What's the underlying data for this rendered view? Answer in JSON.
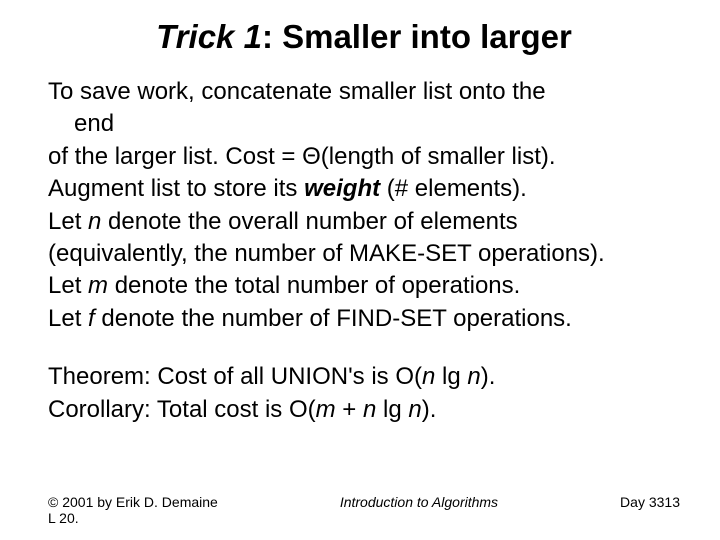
{
  "title_em": "Trick 1",
  "title_rest": ": Smaller into larger",
  "p1a": "To save work, concatenate smaller list onto the",
  "p1b": "end",
  "p2a": "of the larger list. Cost = ",
  "p2b": "Θ",
  "p2c": "(length of smaller list).",
  "p3a": "Augment list to store its ",
  "p3_weight": "weight",
  "p3b": " (# elements).",
  "p4a": "Let ",
  "p4_n": "n",
  "p4b": " denote the overall number of elements",
  "p5": "(equivalently, the number of MAKE-SET operations).",
  "p6a": "Let ",
  "p6_m": "m",
  "p6b": " denote the total number of operations.",
  "p7a": "Let ",
  "p7_f": "f",
  "p7b": " denote the number of FIND-SET operations.",
  "theorema": "Theorem: Cost of all UNION's is O(",
  "theorem_n1": "n",
  "theoremb": " lg ",
  "theorem_n2": "n",
  "theoremc": ").",
  "corola": "Corollary: Total cost is O(",
  "corol_m": "m",
  "corolb": " + ",
  "corol_n1": "n",
  "corolc": " lg ",
  "corol_n2": "n",
  "corold": ").",
  "footer_left_1": "© 2001 by Erik D. Demaine",
  "footer_left_2": "L 20.",
  "footer_center": "Introduction to Algorithms",
  "footer_right": "Day 3313"
}
